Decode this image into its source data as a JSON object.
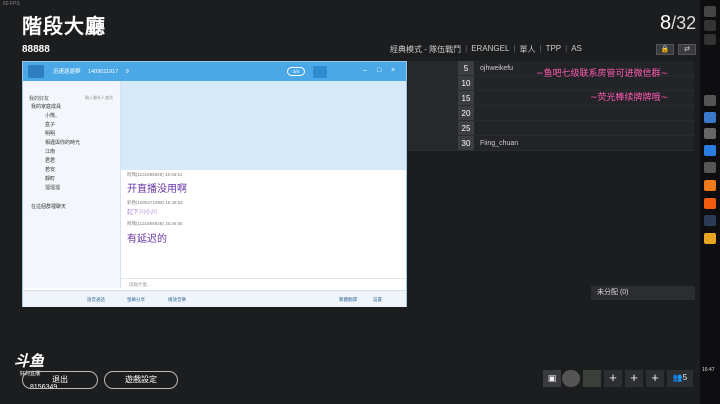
{
  "fps": "60 FPS",
  "header": {
    "title": "階段大廳",
    "room_code": "88888",
    "player_count": "8",
    "player_total": "/32",
    "lock_icon": "lock-icon",
    "swap_icon": "swap-icon"
  },
  "mode_bar": [
    "經典模式 - 隊伍戰鬥",
    "ERANGEL",
    "單人",
    "TPP",
    "AS"
  ],
  "roster": [
    {
      "num": "5",
      "name": "ojhweikefu"
    },
    {
      "num": "10",
      "name": ""
    },
    {
      "num": "15",
      "name": ""
    },
    {
      "num": "20",
      "name": ""
    },
    {
      "num": "25",
      "name": ""
    },
    {
      "num": "30",
      "name": "Fiing_chuan"
    }
  ],
  "captions": {
    "line1": "~鱼吧七级联系房管可进微信群~",
    "line2": "~荧光棒续牌牌哦~"
  },
  "unassigned": "未分配 (0)",
  "chat": {
    "window_title": "迅速巡遊群",
    "group_id": "1409011917",
    "members": "9",
    "counter": "3/4",
    "tree_header": "我的好友",
    "search_hint": "輸入聯系人查找",
    "groups": [
      {
        "label": "我的家庭成員"
      },
      {
        "label": "小熊、"
      },
      {
        "label": "盒子"
      },
      {
        "label": "明明"
      },
      {
        "label": "相遇與你的時光"
      },
      {
        "label": "江南"
      },
      {
        "label": "君君"
      },
      {
        "label": "若安"
      },
      {
        "label": "靜町"
      },
      {
        "label": "溜溜溜"
      },
      {
        "label": "在這個群裡聊天"
      }
    ],
    "messages": [
      {
        "meta": "阿瑪(1131685928)  15:46:51",
        "text": "开直播没用啊",
        "style": "big"
      },
      {
        "meta": "彩色(1505271988)  15:46:54",
        "text": "起下川小川",
        "style": "small"
      },
      {
        "meta": "阿瑪(1131685928)  15:46:55",
        "text": "有延迟的",
        "style": "big"
      }
    ],
    "input_placeholder": "說點什麼...",
    "bottom": {
      "voice": "語音通話",
      "screen": "螢幕分享",
      "music": "播放音樂",
      "send": "發送",
      "translate": "繁體翻譯",
      "display": "設置"
    }
  },
  "footer": {
    "logo": "斗鱼",
    "logo_sub": "好的直播",
    "room_id": "8156349",
    "exit": "退出",
    "settings": "遊戲設定",
    "team_count": "5"
  },
  "clock": "16:47"
}
